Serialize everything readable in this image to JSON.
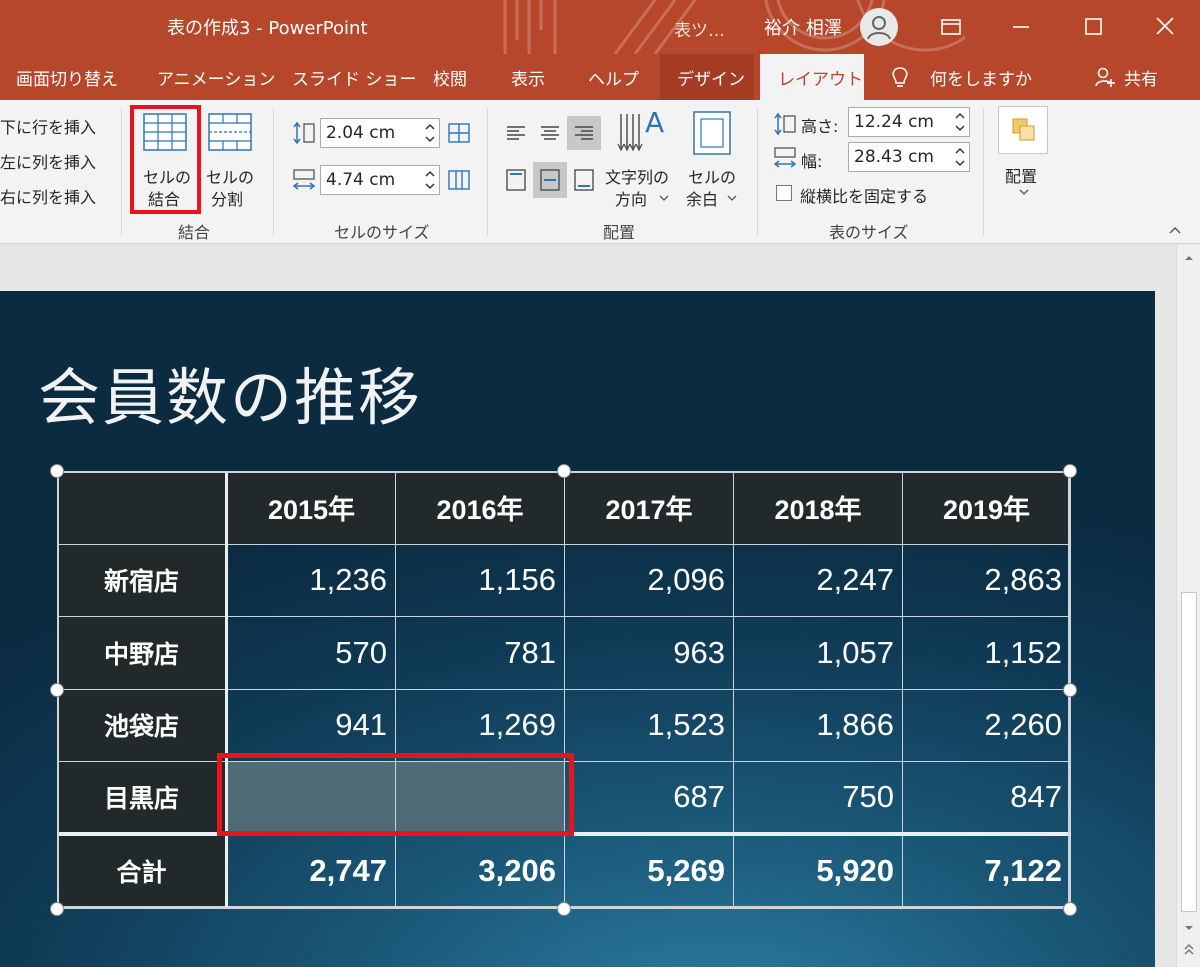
{
  "titlebar": {
    "doc_title": "表の作成3  -  PowerPoint",
    "context_tab": "表ツ…",
    "user_name": "裕介 相澤",
    "colors": {
      "accent": "#b7472a"
    }
  },
  "tabs": {
    "transitions": "画面切り替え",
    "animations": "アニメーション",
    "slideshow": "スライド ショー",
    "review": "校閲",
    "view": "表示",
    "help": "ヘルプ",
    "design": "デザイン",
    "layout": "レイアウト",
    "tellme": "何をしますか",
    "share": "共有"
  },
  "ribbon": {
    "rows_cols": {
      "insert_below": "下に行を挿入",
      "insert_left": "左に列を挿入",
      "insert_right": "右に列を挿入"
    },
    "merge": {
      "merge_cells_1": "セルの",
      "merge_cells_2": "結合",
      "split_cells_1": "セルの",
      "split_cells_2": "分割",
      "group_label": "結合"
    },
    "cell_size": {
      "height_value": "2.04 cm",
      "width_value": "4.74 cm",
      "group_label": "セルのサイズ"
    },
    "alignment": {
      "text_direction_1": "文字列の",
      "text_direction_2": "方向",
      "cell_margins_1": "セルの",
      "cell_margins_2": "余白",
      "group_label": "配置"
    },
    "table_size": {
      "height_label": "高さ:",
      "height_value": "12.24 cm",
      "width_label": "幅:",
      "width_value": "28.43 cm",
      "lock_aspect": "縦横比を固定する",
      "group_label": "表のサイズ"
    },
    "arrange": {
      "label": "配置"
    }
  },
  "slide": {
    "title": "会員数の推移",
    "table": {
      "columns": [
        "",
        "2015年",
        "2016年",
        "2017年",
        "2018年",
        "2019年"
      ],
      "rows": [
        {
          "label": "新宿店",
          "values": [
            "1,236",
            "1,156",
            "2,096",
            "2,247",
            "2,863"
          ]
        },
        {
          "label": "中野店",
          "values": [
            "570",
            "781",
            "963",
            "1,057",
            "1,152"
          ]
        },
        {
          "label": "池袋店",
          "values": [
            "941",
            "1,269",
            "1,523",
            "1,866",
            "2,260"
          ]
        },
        {
          "label": "目黒店",
          "values": [
            "",
            "",
            "687",
            "750",
            "847"
          ]
        },
        {
          "label": "合計",
          "values": [
            "2,747",
            "3,206",
            "5,269",
            "5,920",
            "7,122"
          ]
        }
      ]
    }
  }
}
